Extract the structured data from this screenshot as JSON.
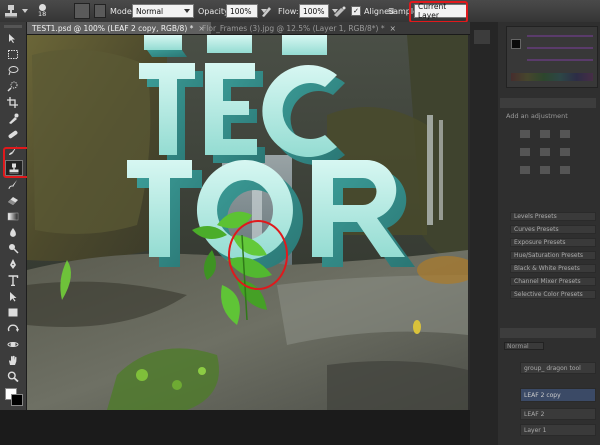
{
  "options_bar": {
    "brush_size": "18",
    "mode_label": "Mode:",
    "mode_value": "Normal",
    "opacity_label": "Opacity:",
    "opacity_value": "100%",
    "flow_label": "Flow:",
    "flow_value": "100%",
    "aligned_label": "Aligned",
    "aligned_checked": true,
    "sample_label": "Sample:",
    "sample_value": "Current Layer"
  },
  "tabs": [
    {
      "label": "TEST1.psd @ 100% (LEAF 2 copy, RGB/8) *",
      "active": true
    },
    {
      "label": "Flor_Frames (3).jpg @ 12.5% (Layer 1, RGB/8*) *",
      "active": false
    }
  ],
  "toolbox": {
    "tools": [
      "move-tool",
      "marquee-tool",
      "lasso-tool",
      "quick-select-tool",
      "crop-tool",
      "eyedropper-tool",
      "healing-brush-tool",
      "brush-tool",
      "clone-stamp-tool",
      "history-brush-tool",
      "eraser-tool",
      "gradient-tool",
      "blur-tool",
      "dodge-tool",
      "pen-tool",
      "type-tool",
      "path-select-tool",
      "shape-tool",
      "3d-rotate-tool",
      "3d-orbit-tool",
      "hand-tool",
      "zoom-tool"
    ],
    "selected_tool": "clone-stamp-tool"
  },
  "canvas": {
    "text_lines": [
      "TEC",
      "TOR"
    ]
  },
  "panels": {
    "adjustments_heading": "Add an adjustment",
    "presets": [
      "Levels Presets",
      "Curves Presets",
      "Exposure Presets",
      "Hue/Saturation Presets",
      "Black & White Presets",
      "Channel Mixer Presets",
      "Selective Color Presets"
    ],
    "layers": {
      "blend_mode": "Normal",
      "items": [
        "group_ dragon tool",
        "LEAF 2 copy",
        "LEAF 2",
        "Layer 1"
      ]
    }
  },
  "colors": {
    "highlight": "#e0191c",
    "letters": "#9fe3da",
    "leaf": "#52b830"
  }
}
